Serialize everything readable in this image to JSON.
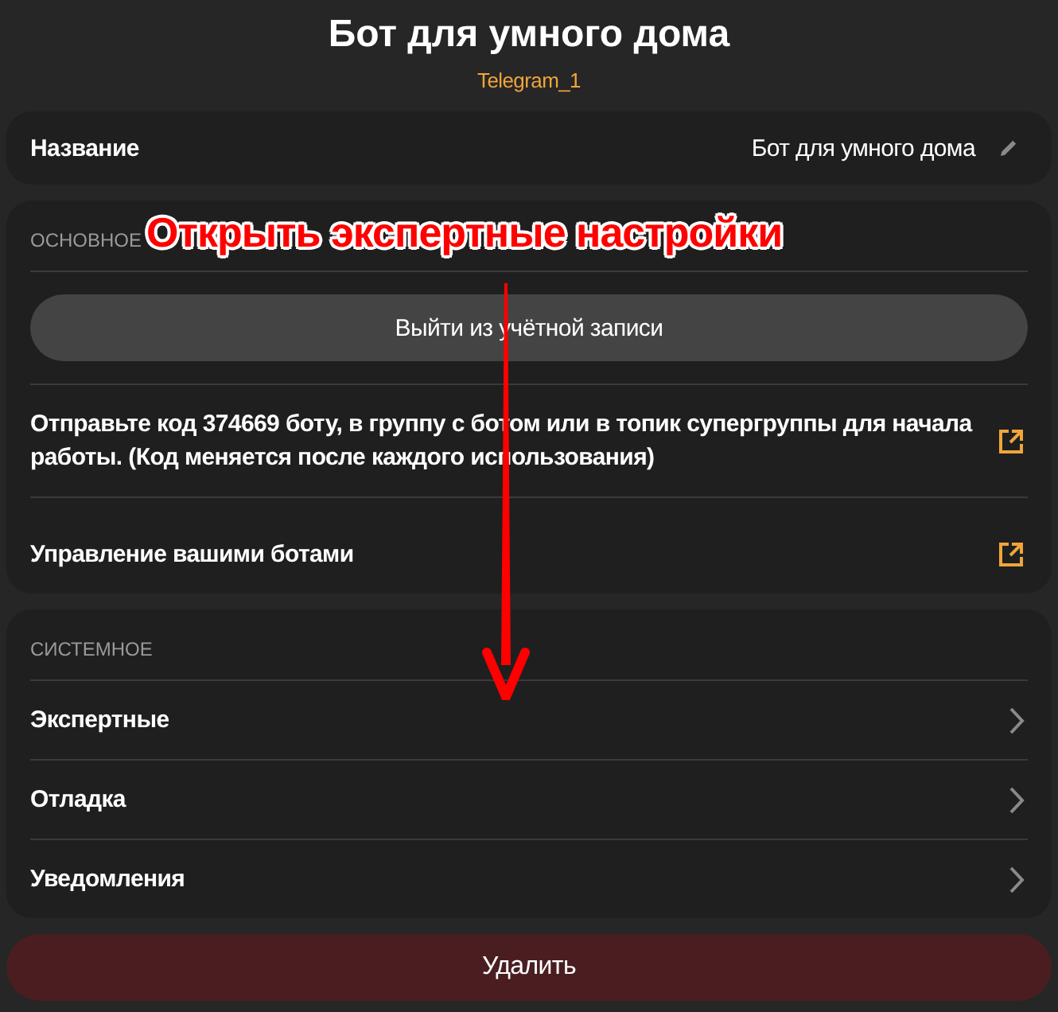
{
  "header": {
    "title": "Бот для умного дома",
    "subtitle": "Telegram_1"
  },
  "name_field": {
    "label": "Название",
    "value": "Бот для умного дома"
  },
  "sections": [
    {
      "heading": "ОСНОВНОЕ",
      "items": [
        {
          "kind": "button",
          "label": "Выйти из учётной записи"
        },
        {
          "kind": "link",
          "label": "Отправьте код 374669 боту, в группу с ботом или в топик супергруппы для начала работы. (Код меняется после каждого использования)"
        },
        {
          "kind": "link",
          "label": "Управление вашими ботами"
        }
      ]
    },
    {
      "heading": "СИСТЕМНОЕ",
      "items": [
        {
          "kind": "nav",
          "label": "Экспертные"
        },
        {
          "kind": "nav",
          "label": "Отладка"
        },
        {
          "kind": "nav",
          "label": "Уведомления"
        }
      ]
    }
  ],
  "delete_button": {
    "label": "Удалить"
  },
  "annotation": {
    "text": "Открыть экспертные настройки"
  }
}
